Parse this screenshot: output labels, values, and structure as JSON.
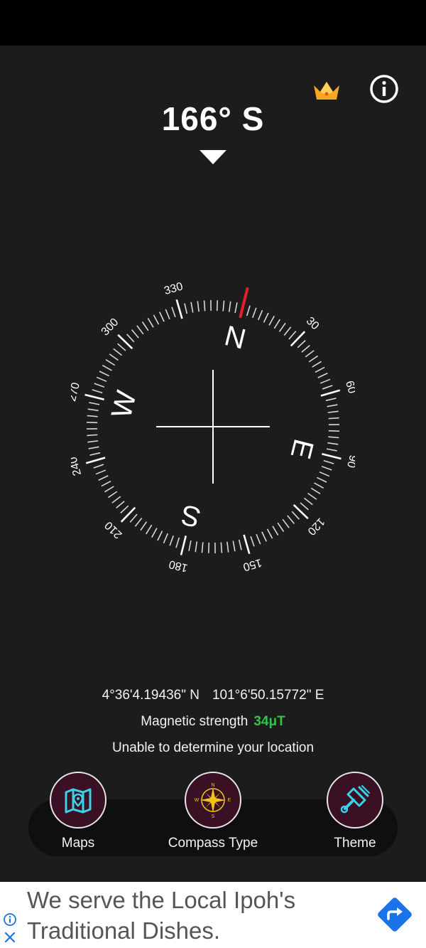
{
  "header": {
    "heading": "166° S",
    "crown_icon": "crown-icon",
    "info_icon": "info-icon"
  },
  "compass": {
    "heading_deg": 166,
    "ticks": [
      "30",
      "60",
      "90",
      "120",
      "150",
      "180",
      "210",
      "240",
      "270",
      "300",
      "330"
    ],
    "cardinals": {
      "N": "N",
      "E": "E",
      "S": "S",
      "W": "W"
    },
    "needle_color": "#e0202a"
  },
  "readings": {
    "latitude": "4°36'4.19436\" N",
    "longitude": "101°6'50.15772\" E",
    "magnetic_label": "Magnetic strength",
    "magnetic_value": "34μT",
    "location_status": "Unable to determine your location"
  },
  "nav": {
    "maps_label": "Maps",
    "compass_type_label": "Compass Type",
    "theme_label": "Theme",
    "maps_icon": "map-icon",
    "compass_type_icon": "compass-rose-icon",
    "theme_icon": "paint-brush-icon"
  },
  "ad": {
    "text": "We serve the Local Ipoh's Traditional Dishes.",
    "info_icon": "ad-info-icon",
    "close_icon": "ad-close-icon",
    "go_icon": "directions-arrow-icon"
  },
  "colors": {
    "background": "#1c1c1c",
    "accent_green": "#36c24a",
    "nav_circle": "#3a1024",
    "crown": "#f5a623",
    "ad_blue": "#1a73e8"
  }
}
